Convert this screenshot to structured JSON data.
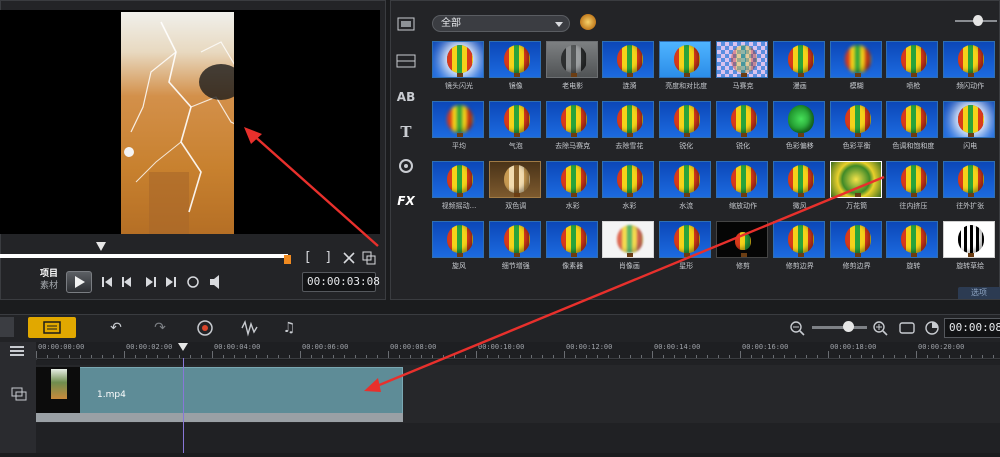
{
  "preview": {
    "mode_project": "项目",
    "mode_clip": "素材",
    "mark_in": "[",
    "mark_out": "]",
    "timecode": "00:00:03:08"
  },
  "library": {
    "category": "全部",
    "side_fx_label": "FX",
    "side_text_label": "T",
    "side_title_label": "AB",
    "effects": [
      {
        "label": "镜头闪光",
        "style": "v-flash"
      },
      {
        "label": "镜像",
        "style": ""
      },
      {
        "label": "老电影",
        "style": "v-gray"
      },
      {
        "label": "涟漪",
        "style": ""
      },
      {
        "label": "亮度和对比度",
        "style": "v-light"
      },
      {
        "label": "马赛克",
        "style": "v-pixel"
      },
      {
        "label": "漫画",
        "style": ""
      },
      {
        "label": "模糊",
        "style": "v-blur"
      },
      {
        "label": "喷枪",
        "style": ""
      },
      {
        "label": "频闪动作",
        "style": ""
      },
      {
        "label": "平均",
        "style": "v-blur"
      },
      {
        "label": "气泡",
        "style": ""
      },
      {
        "label": "去除马赛克",
        "style": ""
      },
      {
        "label": "去除雪花",
        "style": ""
      },
      {
        "label": "锐化",
        "style": ""
      },
      {
        "label": "锐化",
        "style": ""
      },
      {
        "label": "色彩偏移",
        "style": "v-green"
      },
      {
        "label": "色彩平衡",
        "style": ""
      },
      {
        "label": "色调和饱和度",
        "style": ""
      },
      {
        "label": "闪电",
        "style": "v-flash"
      },
      {
        "label": "视频摇动...",
        "style": ""
      },
      {
        "label": "双色调",
        "style": "v-sepia"
      },
      {
        "label": "水彩",
        "style": ""
      },
      {
        "label": "水彩",
        "style": ""
      },
      {
        "label": "水流",
        "style": ""
      },
      {
        "label": "缩放动作",
        "style": ""
      },
      {
        "label": "微风",
        "style": ""
      },
      {
        "label": "万花筒",
        "style": "v-kaleido"
      },
      {
        "label": "往内挤压",
        "style": ""
      },
      {
        "label": "往外扩张",
        "style": ""
      },
      {
        "label": "旋风",
        "style": ""
      },
      {
        "label": "细节增强",
        "style": ""
      },
      {
        "label": "像素器",
        "style": ""
      },
      {
        "label": "肖像画",
        "style": "v-white"
      },
      {
        "label": "星形",
        "style": ""
      },
      {
        "label": "修剪",
        "style": "v-black"
      },
      {
        "label": "修剪边界",
        "style": ""
      },
      {
        "label": "修剪边界",
        "style": ""
      },
      {
        "label": "旋转",
        "style": ""
      },
      {
        "label": "旋转草绘",
        "style": "v-bw"
      }
    ],
    "footer_button": "选项"
  },
  "timeline": {
    "timecode": "00:00:08",
    "ruler_labels": [
      "00:00:00:00",
      "00:00:02:00",
      "00:00:04:00",
      "00:00:06:00",
      "00:00:08:00",
      "00:00:10:00",
      "00:00:12:00",
      "00:00:14:00",
      "00:00:16:00",
      "00:00:18:00",
      "00:00:20:00"
    ],
    "clip_name": "1.mp4"
  },
  "colors": {
    "accent_orange": "#f08a20",
    "timeline_button": "#e1a800",
    "clip_fill": "#5e8c97",
    "annotation_arrow": "#e8302c"
  }
}
